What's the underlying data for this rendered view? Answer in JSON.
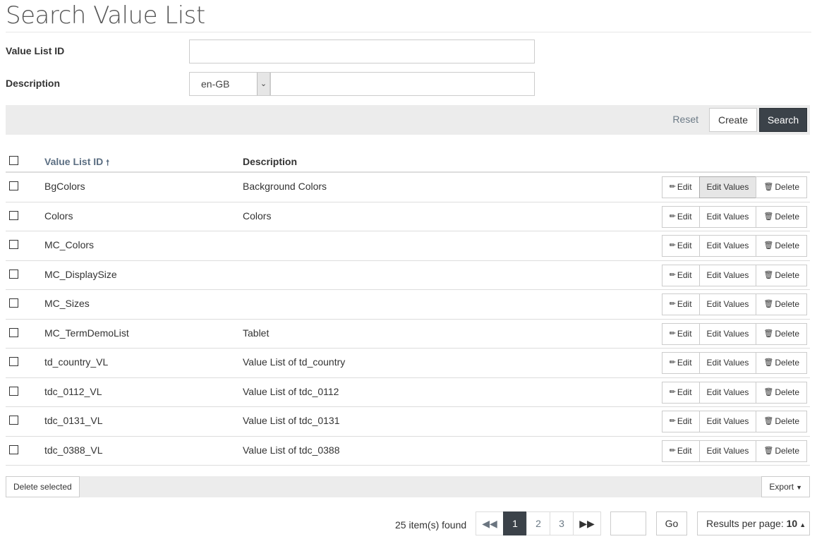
{
  "page": {
    "title": "Search Value List"
  },
  "form": {
    "value_list_id_label": "Value List ID",
    "value_list_id_value": "",
    "description_label": "Description",
    "locale_selected": "en-GB",
    "description_value": ""
  },
  "actions": {
    "reset": "Reset",
    "create": "Create",
    "search": "Search"
  },
  "table": {
    "headers": {
      "value_list_id": "Value List ID",
      "description": "Description"
    },
    "sort_indicator": "🠕",
    "row_actions": {
      "edit": "Edit",
      "edit_values": "Edit Values",
      "delete": "Delete"
    },
    "rows": [
      {
        "id": "BgColors",
        "description": "Background Colors"
      },
      {
        "id": "Colors",
        "description": "Colors"
      },
      {
        "id": "MC_Colors",
        "description": ""
      },
      {
        "id": "MC_DisplaySize",
        "description": ""
      },
      {
        "id": "MC_Sizes",
        "description": ""
      },
      {
        "id": "MC_TermDemoList",
        "description": "Tablet"
      },
      {
        "id": "td_country_VL",
        "description": "Value List of td_country"
      },
      {
        "id": "tdc_0112_VL",
        "description": "Value List of tdc_0112"
      },
      {
        "id": "tdc_0131_VL",
        "description": "Value List of tdc_0131"
      },
      {
        "id": "tdc_0388_VL",
        "description": "Value List of tdc_0388"
      }
    ]
  },
  "bottom": {
    "delete_selected": "Delete selected",
    "export": "Export"
  },
  "pagination": {
    "items_found": "25 item(s) found",
    "pages": [
      "1",
      "2",
      "3"
    ],
    "current_page": "1",
    "goto_value": "",
    "go": "Go",
    "results_per_page_label": "Results per page:",
    "results_per_page_value": "10"
  },
  "colors": {
    "primary": "#3b4249",
    "bar": "#ececec",
    "link": "#5b6e82"
  }
}
